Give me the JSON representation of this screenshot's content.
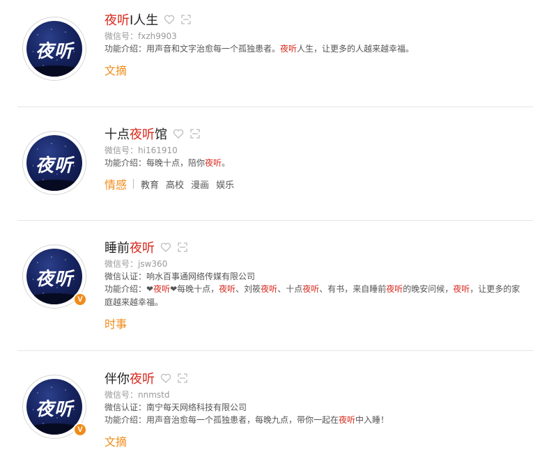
{
  "highlight_color": "#d7261a",
  "tag_color": "#f08c1a",
  "accounts": [
    {
      "avatar_text": "夜听",
      "name_parts": [
        {
          "text": "夜听",
          "hl": true
        },
        {
          "text": "I人生",
          "hl": false
        }
      ],
      "wechat_id": "微信号：fxzh9903",
      "certification": "",
      "intro_parts": [
        {
          "text": "功能介绍：用声音和文字治愈每一个孤独患者。",
          "hl": false
        },
        {
          "text": "夜听",
          "hl": true
        },
        {
          "text": "人生，让更多的人越来越幸福。",
          "hl": false
        }
      ],
      "primary_tag": "文摘",
      "tags": [],
      "verified": false
    },
    {
      "avatar_text": "夜听",
      "name_parts": [
        {
          "text": "十点",
          "hl": false
        },
        {
          "text": "夜听",
          "hl": true
        },
        {
          "text": "馆",
          "hl": false
        }
      ],
      "wechat_id": "微信号：hi161910",
      "certification": "",
      "intro_parts": [
        {
          "text": "功能介绍：每晚十点，陪你",
          "hl": false
        },
        {
          "text": "夜听",
          "hl": true
        },
        {
          "text": "。",
          "hl": false
        }
      ],
      "primary_tag": "情感",
      "tags": [
        "教育",
        "高校",
        "漫画",
        "娱乐"
      ],
      "verified": false
    },
    {
      "avatar_text": "夜听",
      "name_parts": [
        {
          "text": "睡前",
          "hl": false
        },
        {
          "text": "夜听",
          "hl": true
        }
      ],
      "wechat_id": "微信号：jsw360",
      "certification": "微信认证：响水百事通网络传媒有限公司",
      "intro_parts": [
        {
          "text": "功能介绍：❤",
          "hl": false
        },
        {
          "text": "夜听",
          "hl": true
        },
        {
          "text": "❤每晚十点，",
          "hl": false
        },
        {
          "text": "夜听",
          "hl": true
        },
        {
          "text": "、刘筱",
          "hl": false
        },
        {
          "text": "夜听",
          "hl": true
        },
        {
          "text": "、十点",
          "hl": false
        },
        {
          "text": "夜听",
          "hl": true
        },
        {
          "text": "、有书，来自睡前",
          "hl": false
        },
        {
          "text": "夜听",
          "hl": true
        },
        {
          "text": "的晚安问候，",
          "hl": false
        },
        {
          "text": "夜听",
          "hl": true
        },
        {
          "text": "，让更多的家庭越来越幸福。",
          "hl": false
        }
      ],
      "primary_tag": "时事",
      "tags": [],
      "verified": true
    },
    {
      "avatar_text": "夜听",
      "name_parts": [
        {
          "text": "伴你",
          "hl": false
        },
        {
          "text": "夜听",
          "hl": true
        }
      ],
      "wechat_id": "微信号：nnmstd",
      "certification": "微信认证：南宁每天网络科技有限公司",
      "intro_parts": [
        {
          "text": "功能介绍：用声音治愈每一个孤独患者，每晚九点，带你一起在",
          "hl": false
        },
        {
          "text": "夜听",
          "hl": true
        },
        {
          "text": "中入睡！",
          "hl": false
        }
      ],
      "primary_tag": "文摘",
      "tags": [],
      "verified": true
    }
  ],
  "verified_badge": "V"
}
